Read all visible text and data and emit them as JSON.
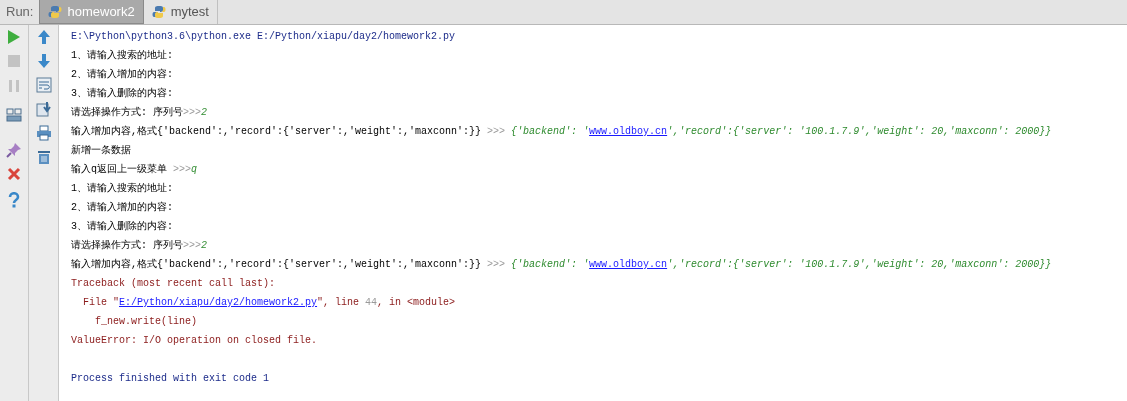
{
  "run_label": "Run:",
  "tabs": [
    {
      "label": "homework2",
      "selected": true
    },
    {
      "label": "mytest",
      "selected": false
    }
  ],
  "console": [
    {
      "segments": [
        {
          "kind": "system",
          "text": "E:\\Python\\python3.6\\python.exe E:/Python/xiapu/day2/homework2.py"
        }
      ]
    },
    {
      "segments": [
        {
          "kind": "stdout",
          "text": "1、请输入搜索的地址:"
        }
      ]
    },
    {
      "segments": [
        {
          "kind": "stdout",
          "text": "2、请输入增加的内容:"
        }
      ]
    },
    {
      "segments": [
        {
          "kind": "stdout",
          "text": "3、请输入删除的内容:"
        }
      ]
    },
    {
      "segments": [
        {
          "kind": "stdout",
          "text": "请选择操作方式: 序列号"
        },
        {
          "kind": "prompt",
          "text": ">>>"
        },
        {
          "kind": "input",
          "text": "2"
        }
      ]
    },
    {
      "segments": [
        {
          "kind": "stdout",
          "text": "输入增加内容,格式{'backend':,'record':{'server':,'weight':,'maxconn':}} "
        },
        {
          "kind": "prompt",
          "text": ">>> "
        },
        {
          "kind": "input",
          "text": "{'backend': '"
        },
        {
          "kind": "link",
          "text": "www.oldboy.cn"
        },
        {
          "kind": "input",
          "text": "','record':{'server': '100.1.7.9','weight': 20,'maxconn': 2000}}"
        }
      ]
    },
    {
      "segments": [
        {
          "kind": "stdout",
          "text": "新增一条数据"
        }
      ]
    },
    {
      "segments": [
        {
          "kind": "stdout",
          "text": "输入q返回上一级菜单 "
        },
        {
          "kind": "prompt",
          "text": ">>>"
        },
        {
          "kind": "input",
          "text": "q"
        }
      ]
    },
    {
      "segments": [
        {
          "kind": "stdout",
          "text": "1、请输入搜索的地址:"
        }
      ]
    },
    {
      "segments": [
        {
          "kind": "stdout",
          "text": "2、请输入增加的内容:"
        }
      ]
    },
    {
      "segments": [
        {
          "kind": "stdout",
          "text": "3、请输入删除的内容:"
        }
      ]
    },
    {
      "segments": [
        {
          "kind": "stdout",
          "text": "请选择操作方式: 序列号"
        },
        {
          "kind": "prompt",
          "text": ">>>"
        },
        {
          "kind": "input",
          "text": "2"
        }
      ]
    },
    {
      "segments": [
        {
          "kind": "stdout",
          "text": "输入增加内容,格式{'backend':,'record':{'server':,'weight':,'maxconn':}} "
        },
        {
          "kind": "prompt",
          "text": ">>> "
        },
        {
          "kind": "input",
          "text": "{'backend': '"
        },
        {
          "kind": "link",
          "text": "www.oldboy.cn"
        },
        {
          "kind": "input",
          "text": "','record':{'server': '100.1.7.9','weight': 20,'maxconn': 2000}}"
        }
      ]
    },
    {
      "segments": [
        {
          "kind": "stderr",
          "text": "Traceback (most recent call last):"
        }
      ]
    },
    {
      "segments": [
        {
          "kind": "stderr",
          "text": "  File \""
        },
        {
          "kind": "link",
          "text": "E:/Python/xiapu/day2/homework2.py"
        },
        {
          "kind": "stderr",
          "text": "\", line "
        },
        {
          "kind": "prompt",
          "text": "44"
        },
        {
          "kind": "stderr",
          "text": ", in <module>"
        }
      ]
    },
    {
      "segments": [
        {
          "kind": "stderr",
          "text": "    f_new.write(line)"
        }
      ]
    },
    {
      "segments": [
        {
          "kind": "stderr",
          "text": "ValueError: I/O operation on closed file."
        }
      ]
    },
    {
      "segments": [
        {
          "kind": "system",
          "text": "Process finished with exit code 1"
        }
      ]
    }
  ]
}
